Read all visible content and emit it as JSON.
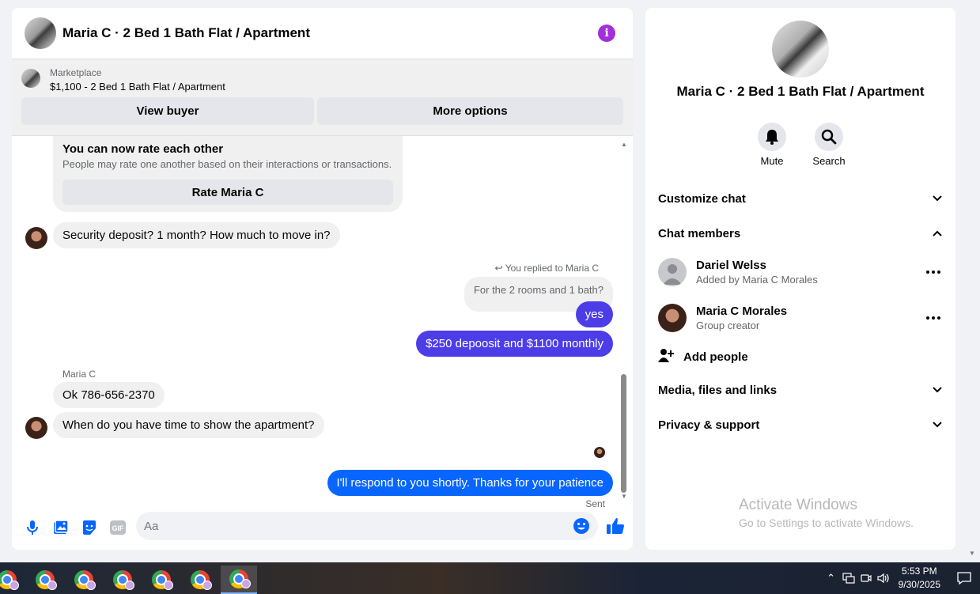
{
  "header": {
    "title": "Maria C · 2 Bed 1 Bath Flat / Apartment"
  },
  "marketplace": {
    "label": "Marketplace",
    "listing": "$1,100 - 2 Bed 1 Bath Flat / Apartment",
    "view_buyer": "View buyer",
    "more_options": "More options"
  },
  "rate": {
    "title": "You can now rate each other",
    "subtitle": "People may rate one another based on their interactions or transactions.",
    "button": "Rate Maria C"
  },
  "messages": {
    "m1": "Security deposit? 1 month? How much to move in?",
    "reply_label": "You replied to Maria C",
    "reply_quote": "For the 2 rooms and 1 bath?",
    "m2": "yes",
    "m3": "$250 depoosit and $1100 monthly",
    "sender": "Maria C",
    "m4": "Ok 786-656-2370",
    "m5": "When do you have time to show the apartment?",
    "m6": "I'll respond to you shortly. Thanks for your patience",
    "sent": "Sent"
  },
  "composer": {
    "placeholder": "Aa"
  },
  "details": {
    "title": "Maria C · 2 Bed 1 Bath Flat / Apartment",
    "mute": "Mute",
    "search": "Search",
    "customize": "Customize chat",
    "members_header": "Chat members",
    "members": [
      {
        "name": "Dariel Welss",
        "sub": "Added by Maria C Morales"
      },
      {
        "name": "Maria C Morales",
        "sub": "Group creator"
      }
    ],
    "add_people": "Add people",
    "media": "Media, files and links",
    "privacy": "Privacy & support"
  },
  "watermark": {
    "title": "Activate Windows",
    "subtitle": "Go to Settings to activate Windows."
  },
  "taskbar": {
    "time": "5:53 PM",
    "date": "9/30/2025"
  },
  "colors": {
    "outgoing": "#4d3de8",
    "outgoing_latest": "#0866ff",
    "accent_info": "#a32fd8",
    "like": "#0866ff"
  }
}
